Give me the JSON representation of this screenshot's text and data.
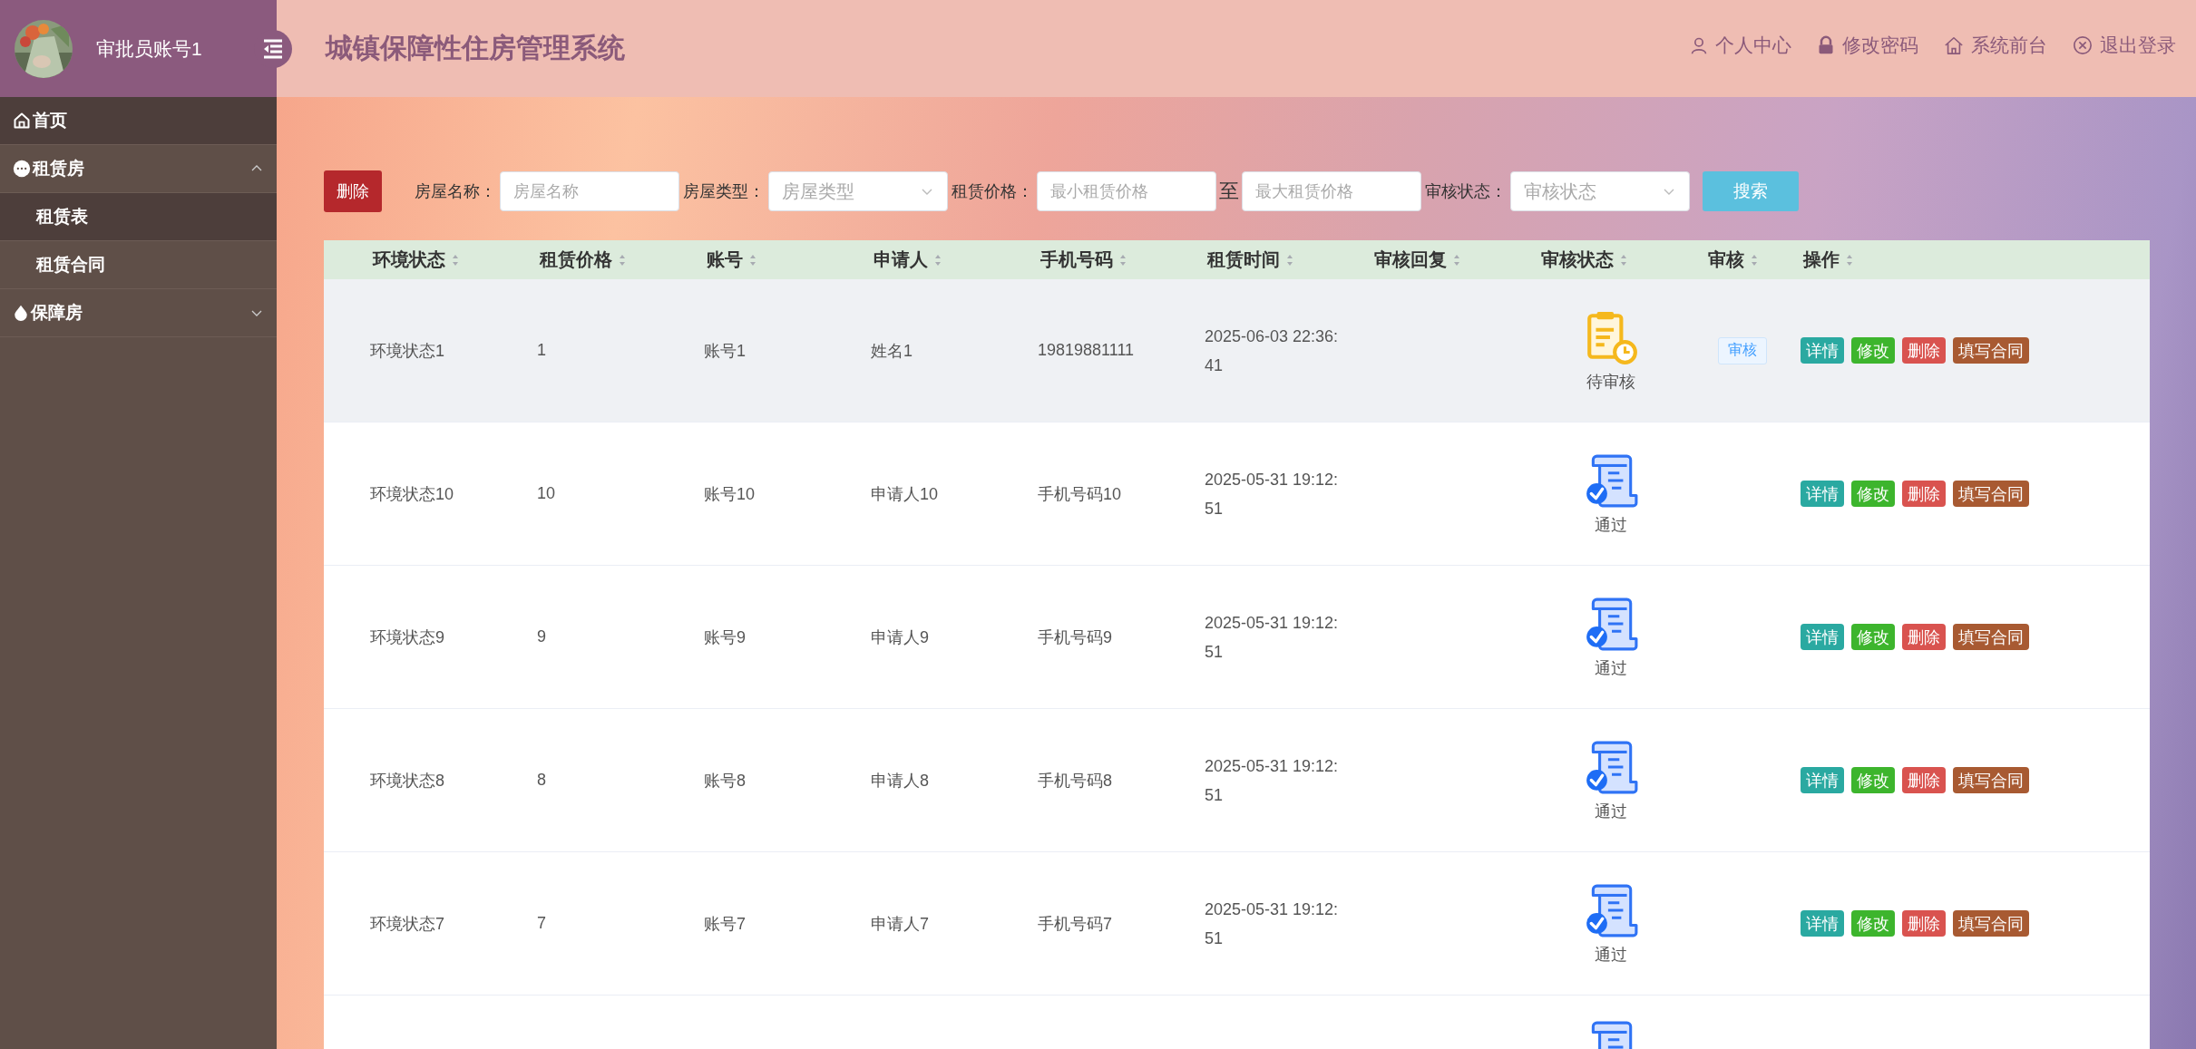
{
  "sidebar": {
    "user_name": "审批员账号1",
    "menu": [
      {
        "label": "首页",
        "kind": "link"
      },
      {
        "label": "租赁房",
        "kind": "group",
        "expanded": true,
        "children": [
          {
            "label": "租赁表",
            "selected": true
          },
          {
            "label": "租赁合同",
            "selected": false
          }
        ]
      },
      {
        "label": "保障房",
        "kind": "group",
        "expanded": false
      }
    ]
  },
  "header": {
    "title": "城镇保障性住房管理系统",
    "links": [
      "个人中心",
      "修改密码",
      "系统前台",
      "退出登录"
    ]
  },
  "filters": {
    "delete_button": "删除",
    "fields": [
      {
        "label": "房屋名称：",
        "kind": "text",
        "placeholder": "房屋名称"
      },
      {
        "label": "房屋类型：",
        "kind": "select",
        "placeholder": "房屋类型"
      },
      {
        "label": "租赁价格：",
        "kind": "range",
        "placeholder": "最小租赁价格",
        "separator": "至",
        "placeholder_max": "最大租赁价格"
      },
      {
        "label": "审核状态：",
        "kind": "select",
        "placeholder": "审核状态"
      }
    ],
    "search_button": "搜索"
  },
  "table": {
    "columns": [
      "环境状态",
      "租赁价格",
      "账号",
      "申请人",
      "手机号码",
      "租赁时间",
      "审核回复",
      "审核状态",
      "审核",
      "操作"
    ],
    "rows": [
      {
        "hovered": true,
        "cells": [
          "环境状态1",
          "1",
          "账号1",
          "姓名1",
          "19819881111",
          "2025-06-03 22:36:41"
        ],
        "status": {
          "kind": "pending",
          "label": "待审核"
        },
        "review_button": "审核",
        "actions": [
          "详情",
          "修改",
          "删除",
          "填写合同"
        ]
      },
      {
        "hovered": false,
        "cells": [
          "环境状态10",
          "10",
          "账号10",
          "申请人10",
          "手机号码10",
          "2025-05-31 19:12:51"
        ],
        "status": {
          "kind": "approved",
          "label": "通过"
        },
        "actions": [
          "详情",
          "修改",
          "删除",
          "填写合同"
        ]
      },
      {
        "hovered": false,
        "cells": [
          "环境状态9",
          "9",
          "账号9",
          "申请人9",
          "手机号码9",
          "2025-05-31 19:12:51"
        ],
        "status": {
          "kind": "approved",
          "label": "通过"
        },
        "actions": [
          "详情",
          "修改",
          "删除",
          "填写合同"
        ]
      },
      {
        "hovered": false,
        "cells": [
          "环境状态8",
          "8",
          "账号8",
          "申请人8",
          "手机号码8",
          "2025-05-31 19:12:51"
        ],
        "status": {
          "kind": "approved",
          "label": "通过"
        },
        "actions": [
          "详情",
          "修改",
          "删除",
          "填写合同"
        ]
      },
      {
        "hovered": false,
        "cells": [
          "环境状态7",
          "7",
          "账号7",
          "申请人7",
          "手机号码7",
          "2025-05-31 19:12:51"
        ],
        "status": {
          "kind": "approved",
          "label": "通过"
        },
        "actions": [
          "详情",
          "修改",
          "删除",
          "填写合同"
        ]
      },
      {
        "hovered": false,
        "status": {
          "kind": "approved"
        }
      }
    ]
  }
}
